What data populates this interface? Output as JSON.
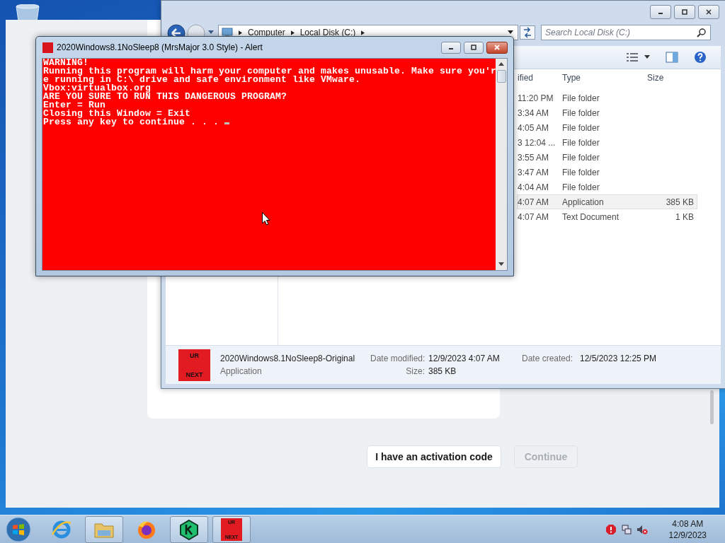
{
  "activation_dialog": {
    "buttons": [
      {
        "label": "I have an activation code",
        "disabled": false
      },
      {
        "label": "Continue",
        "disabled": true
      }
    ]
  },
  "explorer": {
    "breadcrumb": [
      "Computer",
      "Local Disk (C:)"
    ],
    "search": {
      "placeholder": "Search Local Disk (C:)"
    },
    "columns": [
      "ified",
      "Type",
      "Size"
    ],
    "rows": [
      {
        "date": "11:20 PM",
        "type": "File folder",
        "selected": false
      },
      {
        "date": "3:34 AM",
        "type": "File folder",
        "selected": false
      },
      {
        "date": "4:05 AM",
        "type": "File folder",
        "selected": false
      },
      {
        "date": "3 12:04 ...",
        "type": "File folder",
        "selected": false
      },
      {
        "date": "3:55 AM",
        "type": "File folder",
        "selected": false
      },
      {
        "date": "3:47 AM",
        "type": "File folder",
        "selected": false
      },
      {
        "date": "4:04 AM",
        "type": "File folder",
        "selected": false
      },
      {
        "date": "4:07 AM",
        "type": "Application",
        "size": "385 KB",
        "selected": true
      },
      {
        "date": "4:07 AM",
        "type": "Text Document",
        "size": "1 KB",
        "selected": false
      }
    ],
    "details": {
      "icon_text": [
        "UR",
        "NEXT"
      ],
      "name": "2020Windows8.1NoSleep8-Original",
      "type": "Application",
      "fields": [
        {
          "label": "Date modified:",
          "value": "12/9/2023 4:07 AM"
        },
        {
          "label": "Size:",
          "value": "385 KB"
        },
        {
          "label": "Date created:",
          "value": "12/5/2023 12:25 PM"
        }
      ]
    }
  },
  "console": {
    "title": "2020Windows8.1NoSleep8 (MrsMajor 3.0 Style) - Alert",
    "lines": [
      "WARNING!",
      "Running this program will harm your computer and makes unusable. Make sure you'r",
      "e running in C:\\ drive and safe environment like VMware.",
      "Vbox:virtualbox.org",
      "ARE YOU SURE TO RUN THIS DANGEROUS PROGRAM?",
      "Enter = Run",
      "Closing this Window = Exit",
      "Press any key to continue . . . "
    ]
  },
  "taskbar": {
    "apps": [
      {
        "kind": "ie",
        "active": false
      },
      {
        "kind": "explorer",
        "active": true
      },
      {
        "kind": "firefox",
        "active": false
      },
      {
        "kind": "kaspersky",
        "active": true
      },
      {
        "kind": "urnext",
        "active": true,
        "icon_text": [
          "UR",
          "NEXT"
        ]
      }
    ],
    "clock": {
      "time": "4:08 AM",
      "date": "12/9/2023"
    }
  }
}
